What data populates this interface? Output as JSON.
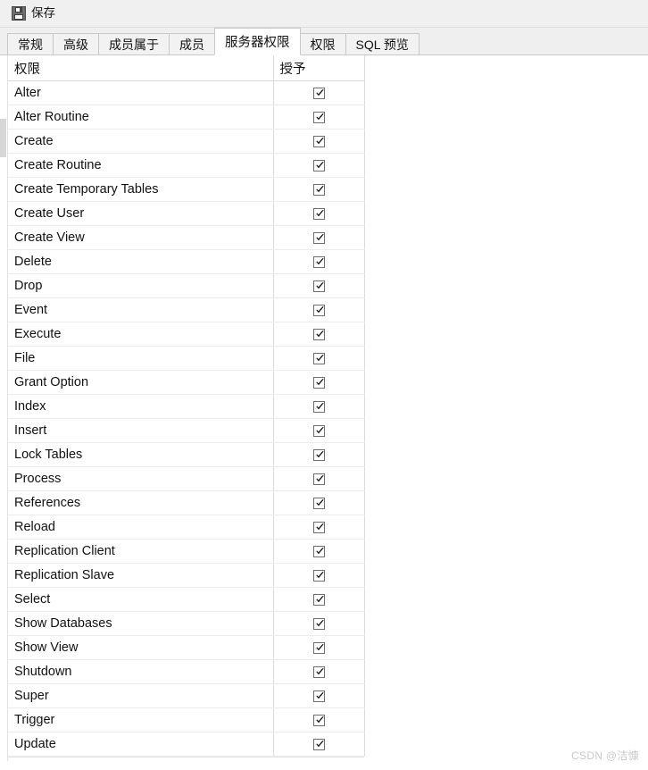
{
  "toolbar": {
    "save_label": "保存",
    "save_icon": "floppy-disk-icon"
  },
  "tabs": [
    {
      "label": "常规",
      "active": false
    },
    {
      "label": "高级",
      "active": false
    },
    {
      "label": "成员属于",
      "active": false
    },
    {
      "label": "成员",
      "active": false
    },
    {
      "label": "服务器权限",
      "active": true
    },
    {
      "label": "权限",
      "active": false
    },
    {
      "label": "SQL 预览",
      "active": false
    }
  ],
  "grid": {
    "columns": [
      "权限",
      "授予"
    ],
    "rows": [
      {
        "privilege": "Alter",
        "granted": true
      },
      {
        "privilege": "Alter Routine",
        "granted": true
      },
      {
        "privilege": "Create",
        "granted": true
      },
      {
        "privilege": "Create Routine",
        "granted": true
      },
      {
        "privilege": "Create Temporary Tables",
        "granted": true
      },
      {
        "privilege": "Create User",
        "granted": true
      },
      {
        "privilege": "Create View",
        "granted": true
      },
      {
        "privilege": "Delete",
        "granted": true
      },
      {
        "privilege": "Drop",
        "granted": true
      },
      {
        "privilege": "Event",
        "granted": true
      },
      {
        "privilege": "Execute",
        "granted": true
      },
      {
        "privilege": "File",
        "granted": true
      },
      {
        "privilege": "Grant Option",
        "granted": true
      },
      {
        "privilege": "Index",
        "granted": true
      },
      {
        "privilege": "Insert",
        "granted": true
      },
      {
        "privilege": "Lock Tables",
        "granted": true
      },
      {
        "privilege": "Process",
        "granted": true
      },
      {
        "privilege": "References",
        "granted": true
      },
      {
        "privilege": "Reload",
        "granted": true
      },
      {
        "privilege": "Replication Client",
        "granted": true
      },
      {
        "privilege": "Replication Slave",
        "granted": true
      },
      {
        "privilege": "Select",
        "granted": true
      },
      {
        "privilege": "Show Databases",
        "granted": true
      },
      {
        "privilege": "Show View",
        "granted": true
      },
      {
        "privilege": "Shutdown",
        "granted": true
      },
      {
        "privilege": "Super",
        "granted": true
      },
      {
        "privilege": "Trigger",
        "granted": true
      },
      {
        "privilege": "Update",
        "granted": true
      }
    ]
  },
  "watermark": {
    "text": "CSDN @洁慷"
  },
  "colors": {
    "toolbar_bg": "#f0f0f0",
    "tab_inactive_bg": "#f2f2f2",
    "tab_active_bg": "#ffffff",
    "border": "#c8c8c8",
    "grid_line": "#ececec",
    "text": "#111111",
    "watermark": "#c9c9c9"
  }
}
